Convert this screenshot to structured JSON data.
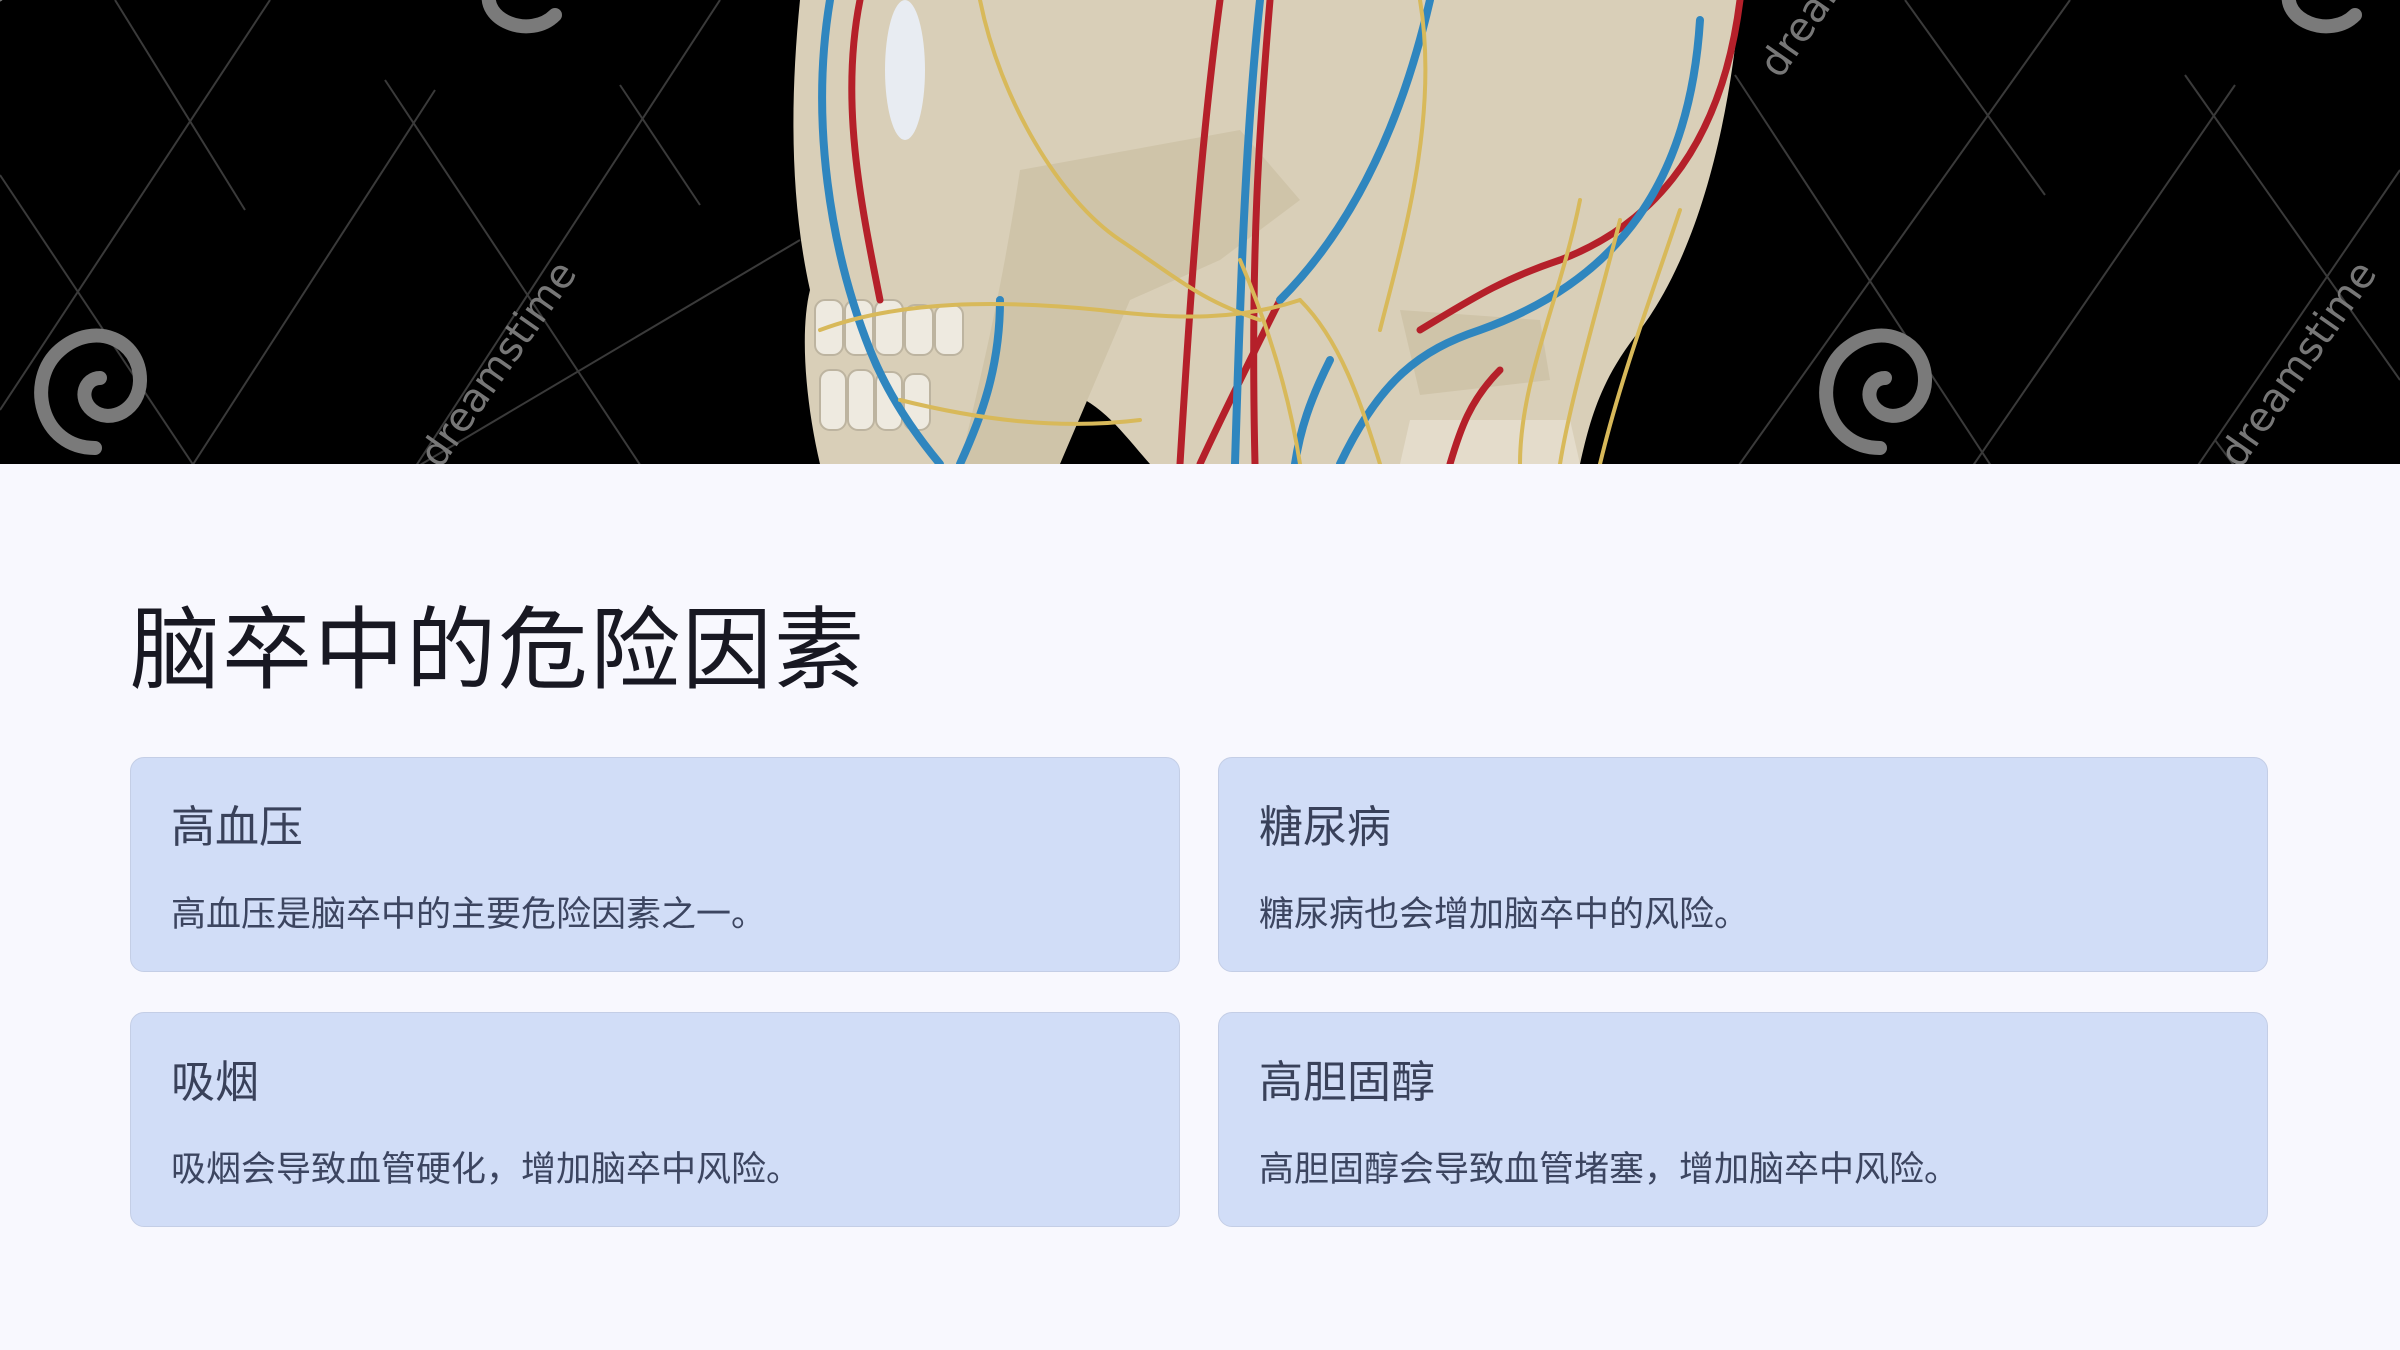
{
  "hero_image": {
    "alt": "头颈部解剖图（颅骨、血管与神经）",
    "watermark_text": "dreamstime",
    "colors": {
      "background": "#000000",
      "bone": "#d9cfb8",
      "artery": "#b5202a",
      "vein": "#2f86bf",
      "nerve": "#d8b95a"
    }
  },
  "page": {
    "title": "脑卒中的危险因素"
  },
  "cards": [
    {
      "title": "高血压",
      "body": "高血压是脑卒中的主要危险因素之一。"
    },
    {
      "title": "糖尿病",
      "body": "糖尿病也会增加脑卒中的风险。"
    },
    {
      "title": "吸烟",
      "body": "吸烟会导致血管硬化，增加脑卒中风险。"
    },
    {
      "title": "高胆固醇",
      "body": "高胆固醇会导致血管堵塞，增加脑卒中风险。"
    }
  ],
  "theme": {
    "page_background": "#f8f8fe",
    "card_background": "#d1ddf7",
    "card_border": "#c4cee6",
    "title_color": "#181822",
    "card_text_color": "#39415a"
  }
}
